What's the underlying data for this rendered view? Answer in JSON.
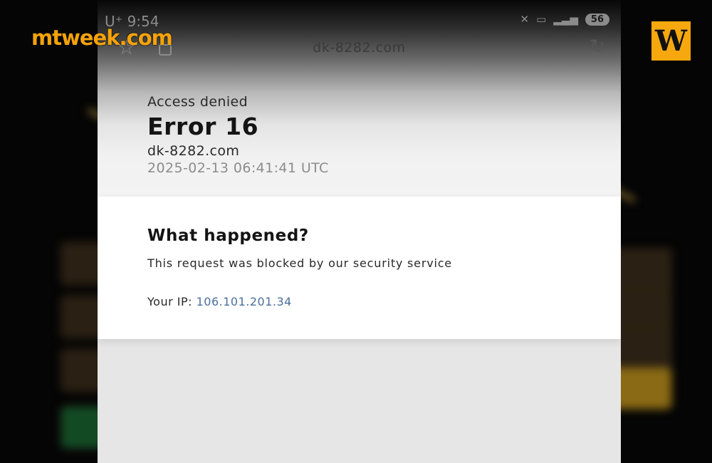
{
  "watermark": {
    "brand": "mtweek.com",
    "logo_letter": "W",
    "brand_color": "#f5a30a"
  },
  "status_bar": {
    "time": "9:54",
    "carrier_mark": "U⁺",
    "battery": "56"
  },
  "browser": {
    "url": "dk-8282.com"
  },
  "error": {
    "heading": "Access denied",
    "title": "Error 16",
    "domain": "dk-8282.com",
    "timestamp": "2025-02-13 06:41:41 UTC"
  },
  "details": {
    "heading": "What happened?",
    "message": "This request was blocked by our security service",
    "ip_label": "Your IP:",
    "ip_value": "106.101.201.34"
  },
  "icons": {
    "bookmark": "star-icon",
    "tabs": "tab-icon",
    "refresh": "refresh-icon"
  },
  "colors": {
    "link": "#4c6f9d",
    "background": "#050505"
  }
}
